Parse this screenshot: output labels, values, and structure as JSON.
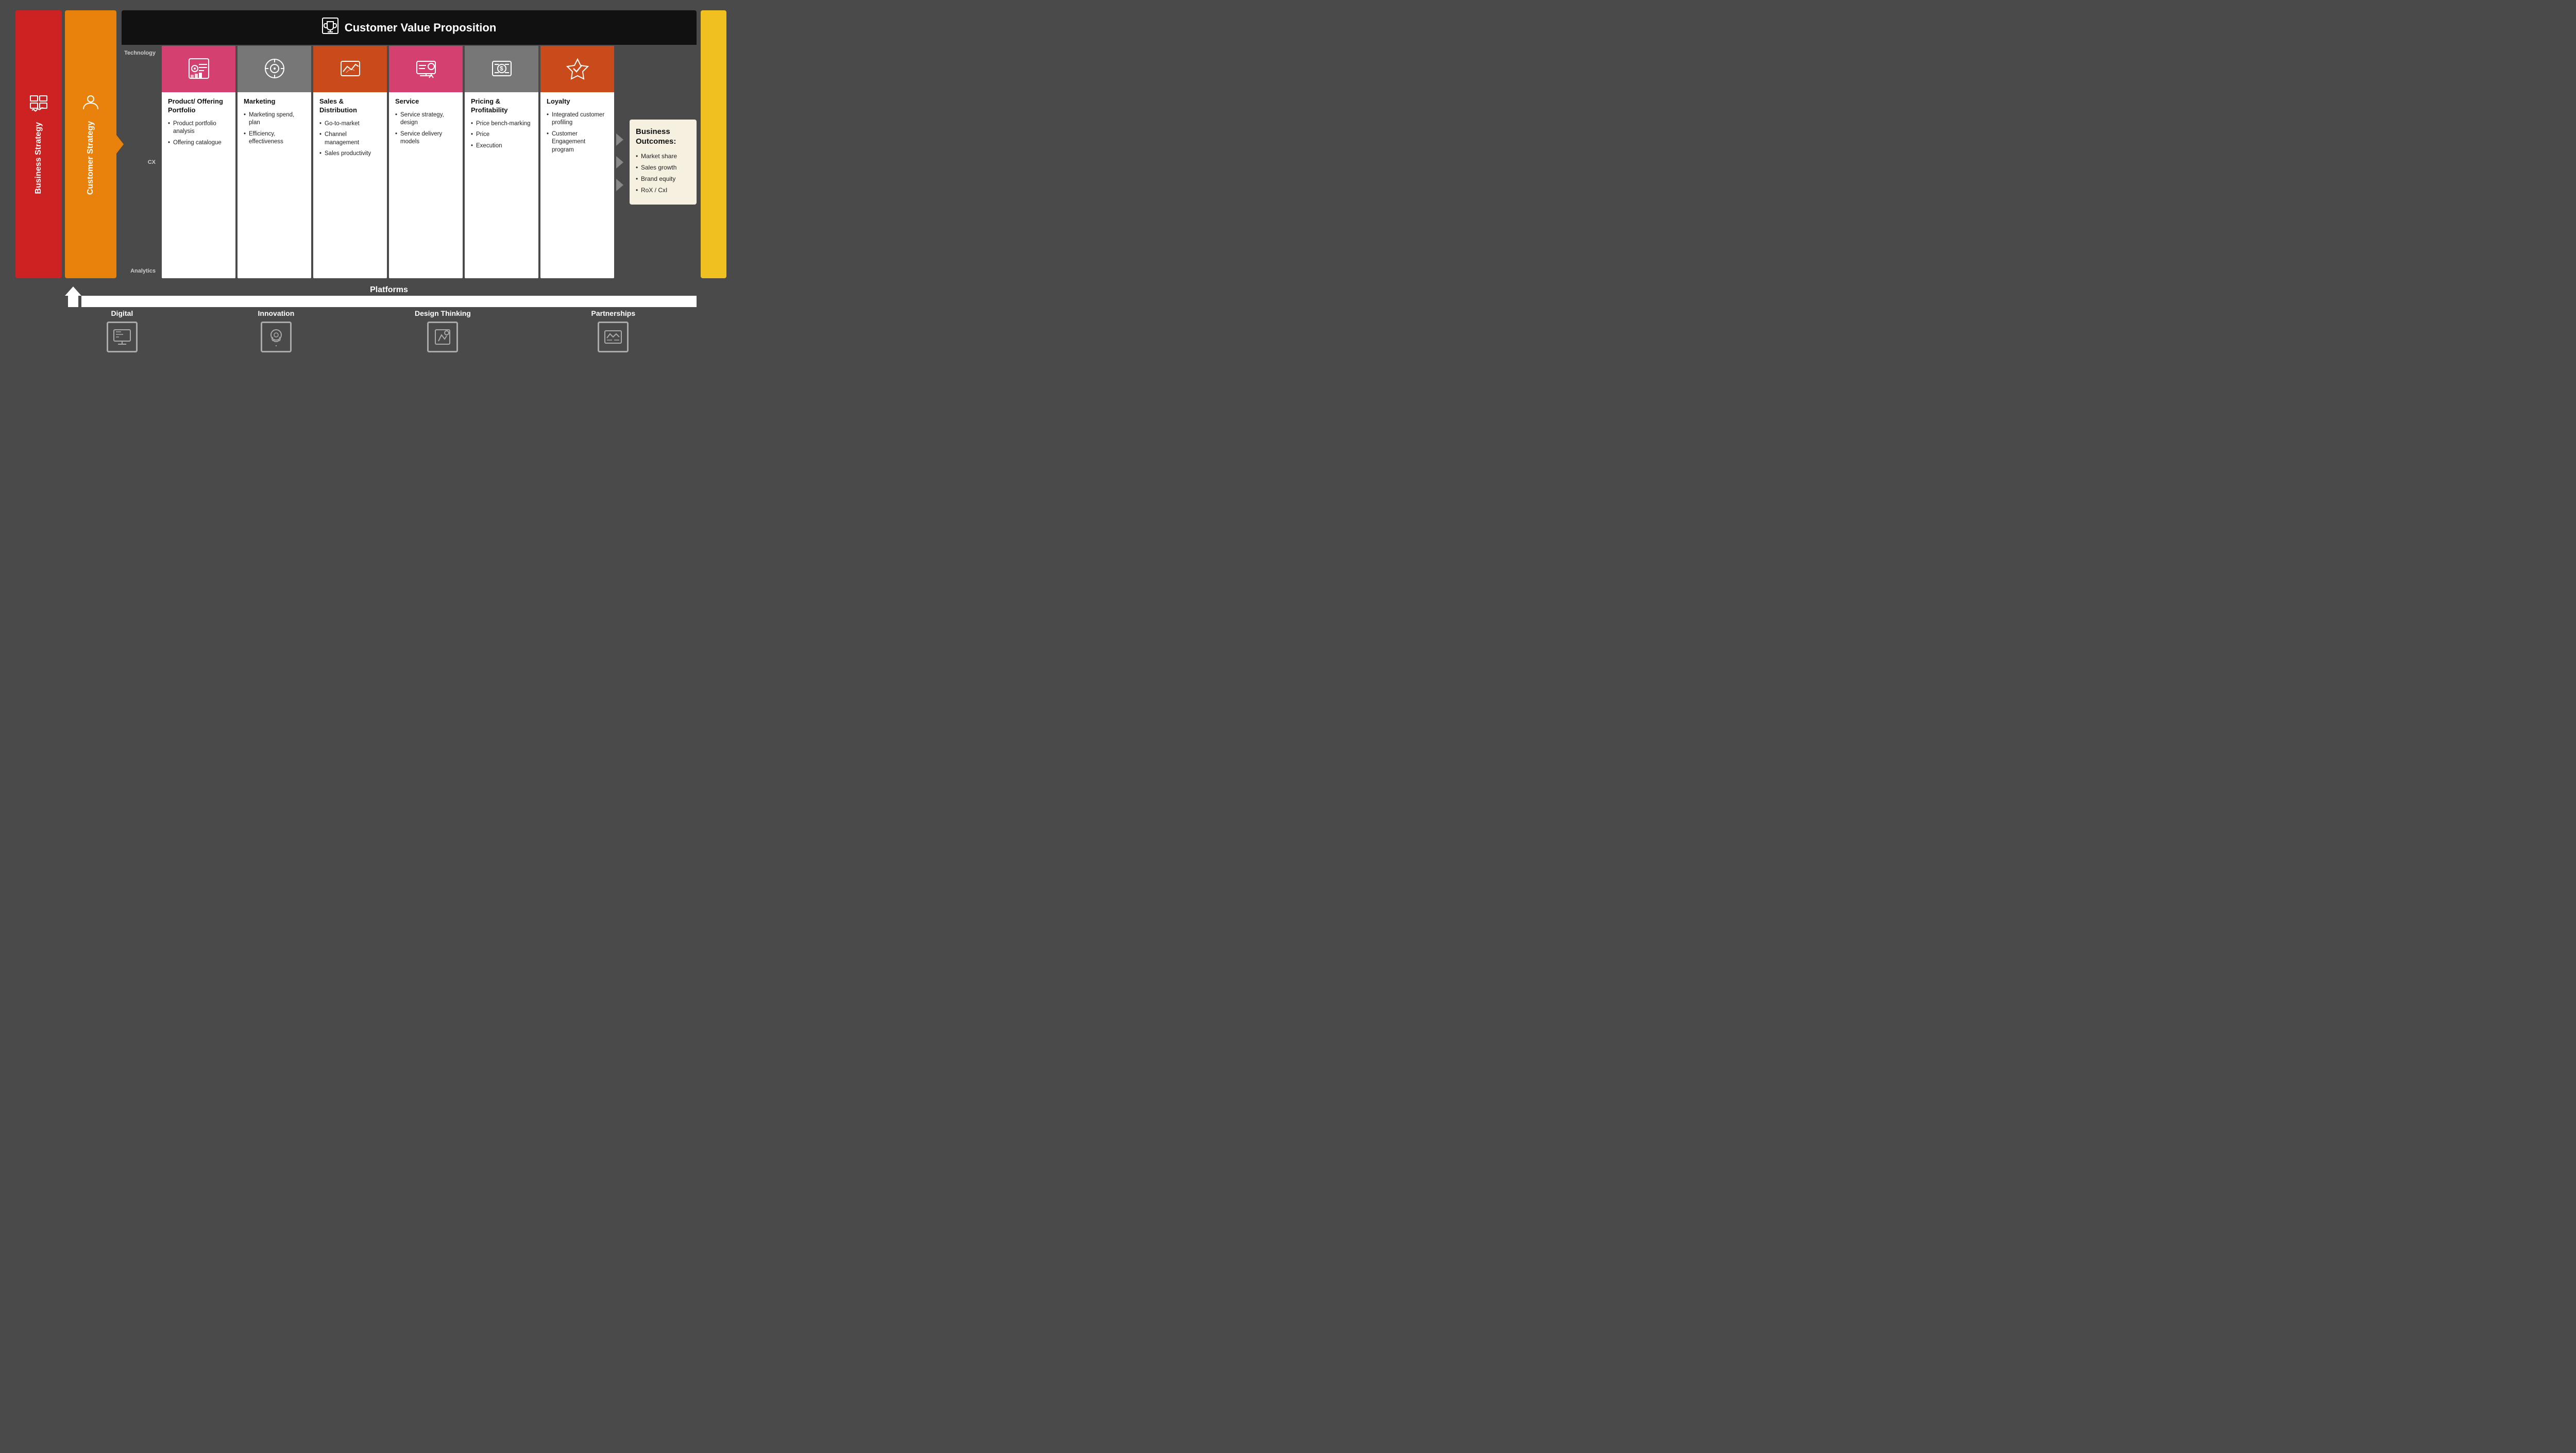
{
  "cvp": {
    "title": "Customer Value Proposition",
    "icon": "🏆"
  },
  "left": {
    "business": {
      "label": "Business Strategy",
      "icon": "📊"
    },
    "customer": {
      "label": "Customer Strategy",
      "icon": "👤"
    }
  },
  "row_labels": [
    "Technology",
    "CX",
    "Analytics"
  ],
  "columns": [
    {
      "id": "product",
      "header_color": "pink",
      "title": "Product/ Offering Portfolio",
      "bullets": [
        "Product portfolio analysis",
        "Offering catalogue"
      ]
    },
    {
      "id": "marketing",
      "header_color": "gray",
      "title": "Marketing",
      "bullets": [
        "Marketing spend, plan",
        "Efficiency, effectiveness"
      ]
    },
    {
      "id": "sales",
      "header_color": "orange",
      "title": "Sales & Distribution",
      "bullets": [
        "Go-to-market",
        "Channel management",
        "Sales productivity"
      ]
    },
    {
      "id": "service",
      "header_color": "pink",
      "title": "Service",
      "bullets": [
        "Service strategy, design",
        "Service delivery models"
      ]
    },
    {
      "id": "pricing",
      "header_color": "gray",
      "title": "Pricing & Profitability",
      "bullets": [
        "Price bench-marking",
        "Price",
        "Execution"
      ]
    },
    {
      "id": "loyalty",
      "header_color": "orange",
      "title": "Loyalty",
      "bullets": [
        "Integrated customer profiling",
        "Customer Engagement program"
      ]
    }
  ],
  "outcomes": {
    "title": "Business Outcomes:",
    "items": [
      "Market share",
      "Sales growth",
      "Brand equity",
      "RoX / CxI"
    ]
  },
  "platforms": {
    "label": "Platforms",
    "items": [
      {
        "id": "digital",
        "label": "Digital"
      },
      {
        "id": "innovation",
        "label": "Innovation"
      },
      {
        "id": "design_thinking",
        "label": "Design Thinking"
      },
      {
        "id": "partnerships",
        "label": "Partnerships"
      }
    ]
  }
}
